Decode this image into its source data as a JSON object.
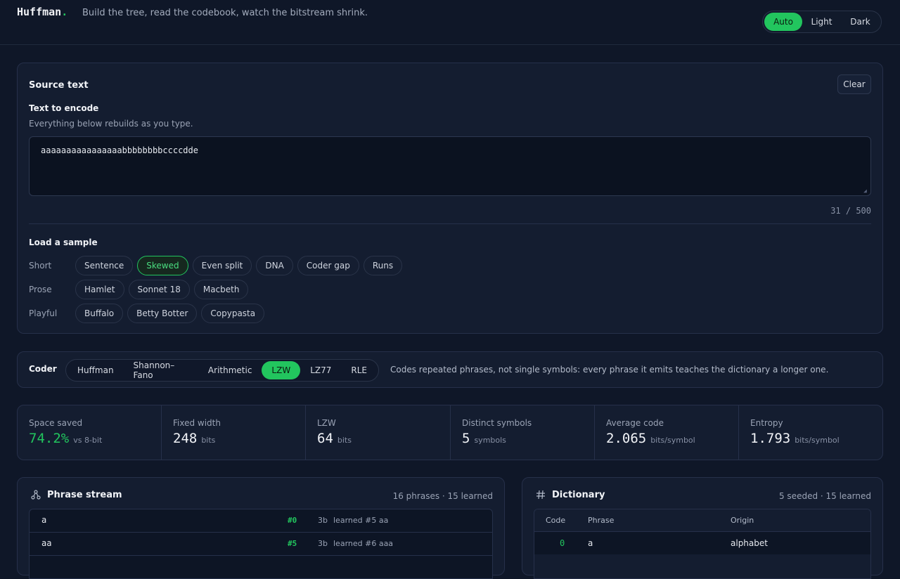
{
  "header": {
    "logo": "Huffman",
    "logo_dot": ".",
    "tagline": "Build the tree, read the codebook, watch the bitstream shrink.",
    "theme_options": [
      {
        "label": "Auto",
        "active": true
      },
      {
        "label": "Light",
        "active": false
      },
      {
        "label": "Dark",
        "active": false
      }
    ]
  },
  "source": {
    "title": "Source text",
    "clear_label": "Clear",
    "field_label": "Text to encode",
    "helper": "Everything below rebuilds as you type.",
    "value": "aaaaaaaaaaaaaaaabbbbbbbbccccdde",
    "counter": "31 / 500",
    "samples_title": "Load a sample",
    "rows": [
      {
        "label": "Short",
        "chips": [
          "Sentence",
          "Skewed",
          "Even split",
          "DNA",
          "Coder gap",
          "Runs"
        ]
      },
      {
        "label": "Prose",
        "chips": [
          "Hamlet",
          "Sonnet 18",
          "Macbeth"
        ]
      },
      {
        "label": "Playful",
        "chips": [
          "Buffalo",
          "Betty Botter",
          "Copypasta"
        ]
      }
    ],
    "active_sample": "Skewed"
  },
  "coder": {
    "label": "Coder",
    "options": [
      "Huffman",
      "Shannon–Fano",
      "Arithmetic",
      "LZW",
      "LZ77",
      "RLE"
    ],
    "active": "LZW",
    "description": "Codes repeated phrases, not single symbols: every phrase it emits teaches the dictionary a longer one."
  },
  "stats": [
    {
      "label": "Space saved",
      "value": "74.2%",
      "unit": "vs 8-bit",
      "highlight": true
    },
    {
      "label": "Fixed width",
      "value": "248",
      "unit": "bits",
      "highlight": false
    },
    {
      "label": "LZW",
      "value": "64",
      "unit": "bits",
      "highlight": false
    },
    {
      "label": "Distinct symbols",
      "value": "5",
      "unit": "symbols",
      "highlight": false
    },
    {
      "label": "Average code",
      "value": "2.065",
      "unit": "bits/symbol",
      "highlight": false
    },
    {
      "label": "Entropy",
      "value": "1.793",
      "unit": "bits/symbol",
      "highlight": false
    }
  ],
  "phrase_stream": {
    "title": "Phrase stream",
    "icon": "share-nodes-icon",
    "meta": "16 phrases · 15 learned",
    "rows": [
      {
        "phrase": "a",
        "code": "#0",
        "bits": "3b",
        "learned": "learned #5 aa"
      },
      {
        "phrase": "aa",
        "code": "#5",
        "bits": "3b",
        "learned": "learned #6 aaa"
      }
    ]
  },
  "dictionary": {
    "title": "Dictionary",
    "icon": "hash-icon",
    "meta": "5 seeded · 15 learned",
    "columns": [
      "Code",
      "Phrase",
      "Origin"
    ],
    "rows": [
      {
        "code": "0",
        "phrase": "a",
        "origin": "alphabet"
      }
    ]
  },
  "colors": {
    "accent": "#22c55e",
    "background": "#0f1728",
    "panel": "#141d30"
  }
}
